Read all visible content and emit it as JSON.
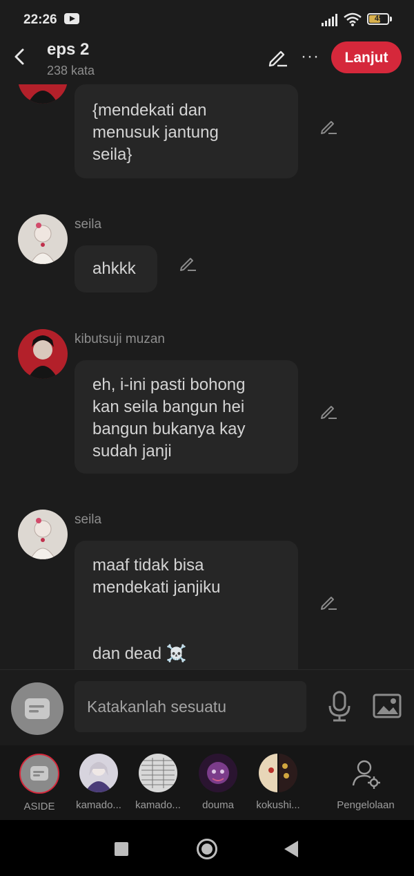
{
  "status_bar": {
    "time": "22:26",
    "battery": "49"
  },
  "header": {
    "title": "eps 2",
    "word_count": "238 kata",
    "more_label": "···",
    "next_label": "Lanjut"
  },
  "messages": [
    {
      "sender": "",
      "text": "{mendekati dan\nmenusuk jantung\nseila}"
    },
    {
      "sender": "seila",
      "text": "ahkkk"
    },
    {
      "sender": "kibutsuji muzan",
      "text": "eh, i-ini pasti bohong\nkan seila bangun hei\nbangun bukanya kay\nsudah janji"
    },
    {
      "sender": "seila",
      "text": "maaf tidak bisa\nmendekati janjiku\n\n\ndan dead ☠️"
    }
  ],
  "input": {
    "placeholder": "Katakanlah sesuatu"
  },
  "characters": [
    {
      "label": "ASIDE"
    },
    {
      "label": "kamado..."
    },
    {
      "label": "kamado..."
    },
    {
      "label": "douma"
    },
    {
      "label": "kokushi..."
    },
    {
      "label": "Pengelolaan"
    }
  ],
  "colors": {
    "accent": "#d5283b",
    "background": "#1c1c1c",
    "bubble": "#262626"
  }
}
